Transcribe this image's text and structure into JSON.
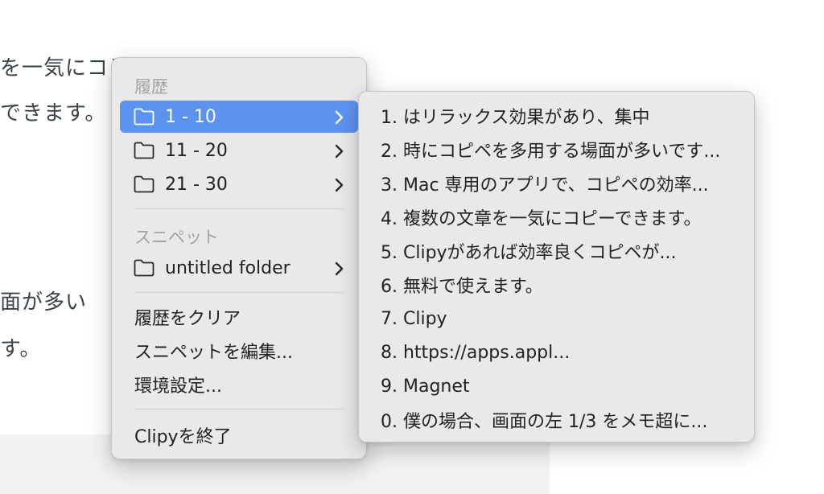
{
  "background": {
    "lines": [
      "を一気にコピーできます",
      "できます。",
      "面が多い",
      "す。"
    ]
  },
  "menu": {
    "history_header": "履歴",
    "history_groups": [
      {
        "label": "1 - 10"
      },
      {
        "label": "11 - 20"
      },
      {
        "label": "21 - 30"
      }
    ],
    "snippet_header": "スニペット",
    "snippet_folder": "untitled folder",
    "clear_history": "履歴をクリア",
    "edit_snippets": "スニペットを編集...",
    "preferences": "環境設定...",
    "quit": "Clipyを終了",
    "highlight_color": "#5d93f0"
  },
  "submenu": {
    "items": [
      "1. はリラックス効果があり、集中",
      "2. 時にコピペを多用する場面が多いです...",
      "3. Mac 専用のアプリで、コピペの効率...",
      "4. 複数の文章を一気にコピーできます。",
      "5. Clipyがあれば効率良くコピペが...",
      "6. 無料で使えます。",
      "7. Clipy",
      "8. https://apps.appl...",
      "9. Magnet",
      "0. 僕の場合、画面の左 1/3 をメモ超に..."
    ]
  }
}
